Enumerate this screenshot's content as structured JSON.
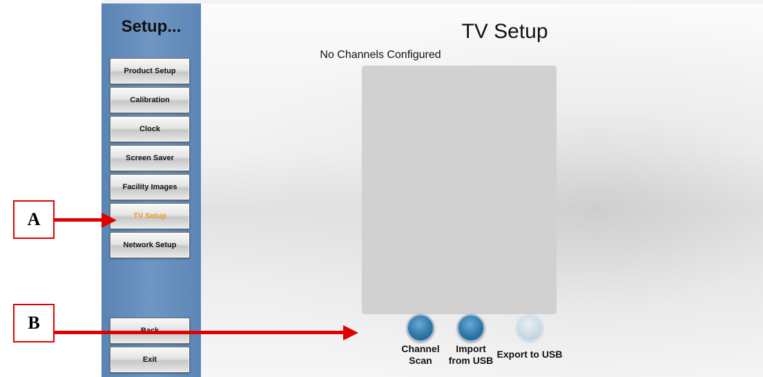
{
  "sidebar": {
    "title": "Setup...",
    "items": [
      {
        "label": "Product Setup",
        "active": false
      },
      {
        "label": "Calibration",
        "active": false
      },
      {
        "label": "Clock",
        "active": false
      },
      {
        "label": "Screen Saver",
        "active": false
      },
      {
        "label": "Facility Images",
        "active": false
      },
      {
        "label": "TV Setup",
        "active": true
      },
      {
        "label": "Network Setup",
        "active": false
      }
    ],
    "bottom": {
      "back_label": "Back",
      "exit_label": "Exit"
    }
  },
  "main": {
    "title": "TV Setup",
    "channels_status": "No Channels Configured",
    "actions": [
      {
        "label": "Channel\nScan",
        "enabled": true
      },
      {
        "label": "Import\nfrom USB",
        "enabled": true
      },
      {
        "label": "Export to USB",
        "enabled": false
      }
    ]
  },
  "callouts": {
    "a": "A",
    "b": "B"
  },
  "colors": {
    "sidebar": "#6f96c3",
    "active_item": "#f19a1b",
    "callout": "#e00000",
    "action_button": "#2f78aa"
  }
}
